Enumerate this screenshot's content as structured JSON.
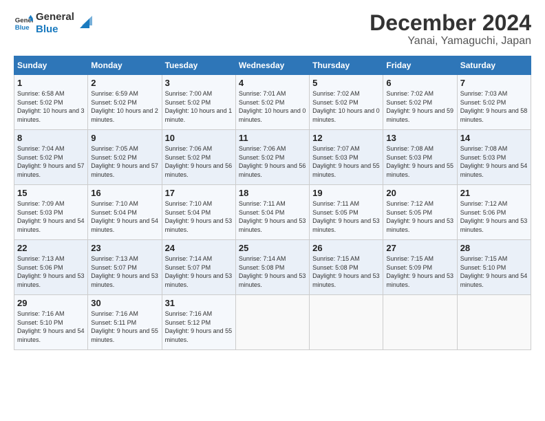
{
  "logo": {
    "line1": "General",
    "line2": "Blue"
  },
  "title": "December 2024",
  "subtitle": "Yanai, Yamaguchi, Japan",
  "weekdays": [
    "Sunday",
    "Monday",
    "Tuesday",
    "Wednesday",
    "Thursday",
    "Friday",
    "Saturday"
  ],
  "weeks": [
    [
      {
        "day": "1",
        "sunrise": "6:58 AM",
        "sunset": "5:02 PM",
        "daylight": "10 hours and 3 minutes."
      },
      {
        "day": "2",
        "sunrise": "6:59 AM",
        "sunset": "5:02 PM",
        "daylight": "10 hours and 2 minutes."
      },
      {
        "day": "3",
        "sunrise": "7:00 AM",
        "sunset": "5:02 PM",
        "daylight": "10 hours and 1 minute."
      },
      {
        "day": "4",
        "sunrise": "7:01 AM",
        "sunset": "5:02 PM",
        "daylight": "10 hours and 0 minutes."
      },
      {
        "day": "5",
        "sunrise": "7:02 AM",
        "sunset": "5:02 PM",
        "daylight": "10 hours and 0 minutes."
      },
      {
        "day": "6",
        "sunrise": "7:02 AM",
        "sunset": "5:02 PM",
        "daylight": "9 hours and 59 minutes."
      },
      {
        "day": "7",
        "sunrise": "7:03 AM",
        "sunset": "5:02 PM",
        "daylight": "9 hours and 58 minutes."
      }
    ],
    [
      {
        "day": "8",
        "sunrise": "7:04 AM",
        "sunset": "5:02 PM",
        "daylight": "9 hours and 57 minutes."
      },
      {
        "day": "9",
        "sunrise": "7:05 AM",
        "sunset": "5:02 PM",
        "daylight": "9 hours and 57 minutes."
      },
      {
        "day": "10",
        "sunrise": "7:06 AM",
        "sunset": "5:02 PM",
        "daylight": "9 hours and 56 minutes."
      },
      {
        "day": "11",
        "sunrise": "7:06 AM",
        "sunset": "5:02 PM",
        "daylight": "9 hours and 56 minutes."
      },
      {
        "day": "12",
        "sunrise": "7:07 AM",
        "sunset": "5:03 PM",
        "daylight": "9 hours and 55 minutes."
      },
      {
        "day": "13",
        "sunrise": "7:08 AM",
        "sunset": "5:03 PM",
        "daylight": "9 hours and 55 minutes."
      },
      {
        "day": "14",
        "sunrise": "7:08 AM",
        "sunset": "5:03 PM",
        "daylight": "9 hours and 54 minutes."
      }
    ],
    [
      {
        "day": "15",
        "sunrise": "7:09 AM",
        "sunset": "5:03 PM",
        "daylight": "9 hours and 54 minutes."
      },
      {
        "day": "16",
        "sunrise": "7:10 AM",
        "sunset": "5:04 PM",
        "daylight": "9 hours and 54 minutes."
      },
      {
        "day": "17",
        "sunrise": "7:10 AM",
        "sunset": "5:04 PM",
        "daylight": "9 hours and 53 minutes."
      },
      {
        "day": "18",
        "sunrise": "7:11 AM",
        "sunset": "5:04 PM",
        "daylight": "9 hours and 53 minutes."
      },
      {
        "day": "19",
        "sunrise": "7:11 AM",
        "sunset": "5:05 PM",
        "daylight": "9 hours and 53 minutes."
      },
      {
        "day": "20",
        "sunrise": "7:12 AM",
        "sunset": "5:05 PM",
        "daylight": "9 hours and 53 minutes."
      },
      {
        "day": "21",
        "sunrise": "7:12 AM",
        "sunset": "5:06 PM",
        "daylight": "9 hours and 53 minutes."
      }
    ],
    [
      {
        "day": "22",
        "sunrise": "7:13 AM",
        "sunset": "5:06 PM",
        "daylight": "9 hours and 53 minutes."
      },
      {
        "day": "23",
        "sunrise": "7:13 AM",
        "sunset": "5:07 PM",
        "daylight": "9 hours and 53 minutes."
      },
      {
        "day": "24",
        "sunrise": "7:14 AM",
        "sunset": "5:07 PM",
        "daylight": "9 hours and 53 minutes."
      },
      {
        "day": "25",
        "sunrise": "7:14 AM",
        "sunset": "5:08 PM",
        "daylight": "9 hours and 53 minutes."
      },
      {
        "day": "26",
        "sunrise": "7:15 AM",
        "sunset": "5:08 PM",
        "daylight": "9 hours and 53 minutes."
      },
      {
        "day": "27",
        "sunrise": "7:15 AM",
        "sunset": "5:09 PM",
        "daylight": "9 hours and 53 minutes."
      },
      {
        "day": "28",
        "sunrise": "7:15 AM",
        "sunset": "5:10 PM",
        "daylight": "9 hours and 54 minutes."
      }
    ],
    [
      {
        "day": "29",
        "sunrise": "7:16 AM",
        "sunset": "5:10 PM",
        "daylight": "9 hours and 54 minutes."
      },
      {
        "day": "30",
        "sunrise": "7:16 AM",
        "sunset": "5:11 PM",
        "daylight": "9 hours and 55 minutes."
      },
      {
        "day": "31",
        "sunrise": "7:16 AM",
        "sunset": "5:12 PM",
        "daylight": "9 hours and 55 minutes."
      },
      null,
      null,
      null,
      null
    ]
  ],
  "labels": {
    "sunrise": "Sunrise:",
    "sunset": "Sunset:",
    "daylight": "Daylight:"
  }
}
